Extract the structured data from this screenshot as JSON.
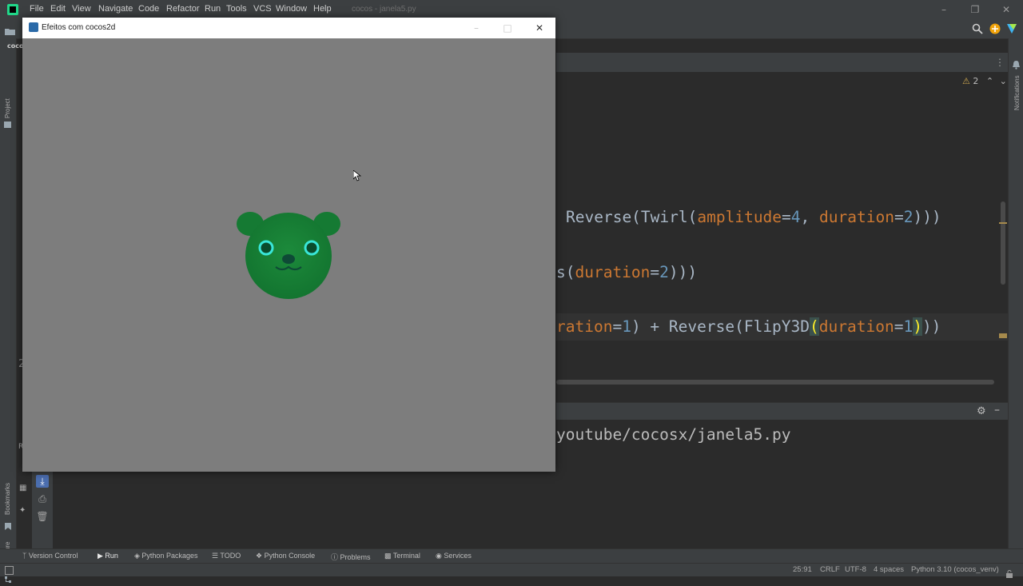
{
  "menu": {
    "items": [
      "File",
      "Edit",
      "View",
      "Navigate",
      "Code",
      "Refactor",
      "Run",
      "Tools",
      "VCS",
      "Window",
      "Help"
    ],
    "window_title": "cocos - janela5.py"
  },
  "left_strip": {
    "project": "Project",
    "bookmarks": "Bookmarks",
    "structure": "Structure",
    "run_letter": "R",
    "line_fragment": "2",
    "project_fragment": "coco"
  },
  "right_strip": {
    "notifications": "Notifications"
  },
  "inspection": {
    "warnings": "2"
  },
  "editor": {
    "line1": {
      "a": "Reverse(Twirl(",
      "b": "amplitude",
      "c": "=",
      "d": "4",
      "e": ", ",
      "f": "duration",
      "g": "=",
      "h": "2",
      "i": ")))"
    },
    "line2": {
      "a": "s(",
      "b": "duration",
      "c": "=",
      "d": "2",
      "e": ")))"
    },
    "line3": {
      "a": "ration",
      "b": "=",
      "c": "1",
      "d": ") + Reverse(FlipY3D",
      "e": "(",
      "f": "duration",
      "g": "=",
      "h": "1",
      "i": ")",
      "j": "))"
    }
  },
  "run_output": {
    "text": "youtube/cocosx/janela5.py"
  },
  "tool_windows": [
    "Version Control",
    "Run",
    "Python Packages",
    "TODO",
    "Python Console",
    "Problems",
    "Terminal",
    "Services"
  ],
  "status": {
    "position": "25:91",
    "line_sep": "CRLF",
    "encoding": "UTF-8",
    "indent": "4 spaces",
    "interpreter": "Python 3.10 (cocos_venv)"
  },
  "app_window": {
    "title": "Efeitos com cocos2d"
  },
  "colors": {
    "bear_green": "#1e8a3a",
    "bear_eye": "#39e6d8",
    "canvas_gray": "#7d7d7d"
  }
}
